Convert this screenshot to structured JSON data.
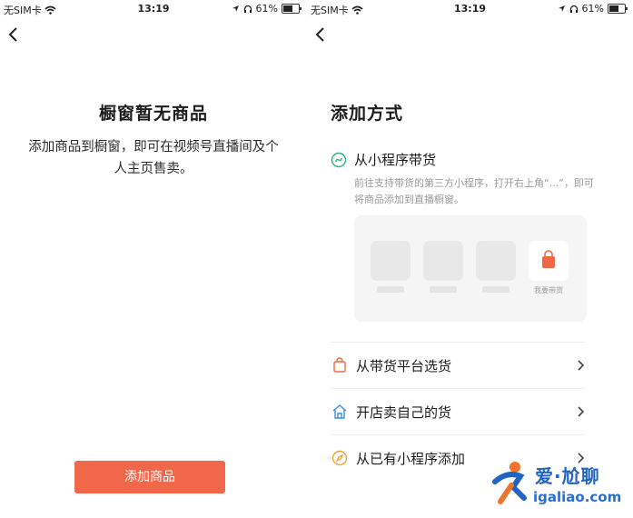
{
  "left": {
    "status": {
      "carrier": "无SIM卡",
      "time": "13:19",
      "battery": "61%"
    },
    "empty_title": "橱窗暂无商品",
    "empty_desc": "添加商品到橱窗，即可在视频号直播间及个人主页售卖。",
    "add_button": "添加商品"
  },
  "right": {
    "status": {
      "carrier": "无SIM卡",
      "time": "13:19",
      "battery": "61%"
    },
    "title": "添加方式",
    "mini_program": {
      "label": "从小程序带货",
      "desc": "前往支持带货的第三方小程序，打开右上角“...”，即可将商品添加到直播橱窗。",
      "preview_caption": "我要带货"
    },
    "options": [
      {
        "label": "从带货平台选货",
        "icon": "shopping-bag-icon"
      },
      {
        "label": "开店卖自己的货",
        "icon": "store-icon"
      },
      {
        "label": "从已有小程序添加",
        "icon": "compass-icon"
      }
    ]
  },
  "watermark": {
    "text": "爱·尬聊",
    "url": "igaliao.com"
  },
  "colors": {
    "accent": "#f0674a",
    "green": "#2bb673",
    "blue": "#1f63c4"
  },
  "icons": [
    "wifi-icon",
    "location-icon",
    "headphone-icon",
    "battery-icon",
    "back-chevron-icon",
    "chevron-right-icon"
  ]
}
